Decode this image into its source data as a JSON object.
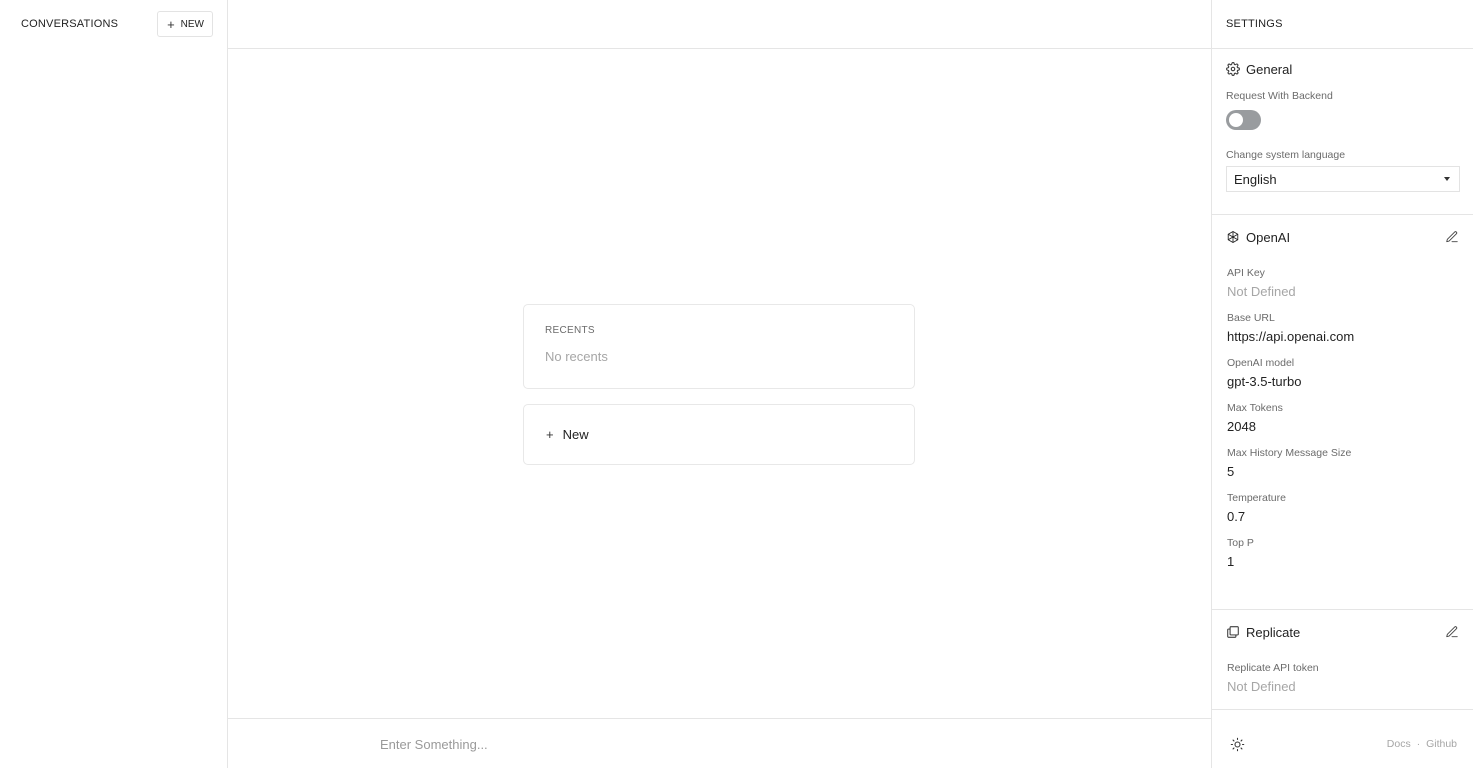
{
  "left_sidebar": {
    "title": "CONVERSATIONS",
    "new_button": "NEW"
  },
  "main": {
    "recents_title": "RECENTS",
    "recents_empty": "No recents",
    "new_label": "New",
    "input_placeholder": "Enter Something..."
  },
  "settings": {
    "title": "SETTINGS",
    "general": {
      "title": "General",
      "backend_label": "Request With Backend",
      "backend_enabled": false,
      "language_label": "Change system language",
      "language_value": "English"
    },
    "openai": {
      "title": "OpenAI",
      "fields": [
        {
          "label": "API Key",
          "value": "Not Defined",
          "muted": true
        },
        {
          "label": "Base URL",
          "value": "https://api.openai.com",
          "muted": false
        },
        {
          "label": "OpenAI model",
          "value": "gpt-3.5-turbo",
          "muted": false
        },
        {
          "label": "Max Tokens",
          "value": "2048",
          "muted": false
        },
        {
          "label": "Max History Message Size",
          "value": "5",
          "muted": false
        },
        {
          "label": "Temperature",
          "value": "0.7",
          "muted": false
        },
        {
          "label": "Top P",
          "value": "1",
          "muted": false
        }
      ]
    },
    "replicate": {
      "title": "Replicate",
      "token_label": "Replicate API token",
      "token_value": "Not Defined"
    },
    "footer": {
      "docs": "Docs",
      "separator": "·",
      "github": "Github"
    }
  },
  "icons": {
    "plus": "plus-icon",
    "gear": "gear-icon",
    "openai": "openai-logo-icon",
    "replicate": "replicate-icon",
    "edit": "edit-icon",
    "sun": "sun-icon",
    "caret": "caret-down-icon"
  }
}
